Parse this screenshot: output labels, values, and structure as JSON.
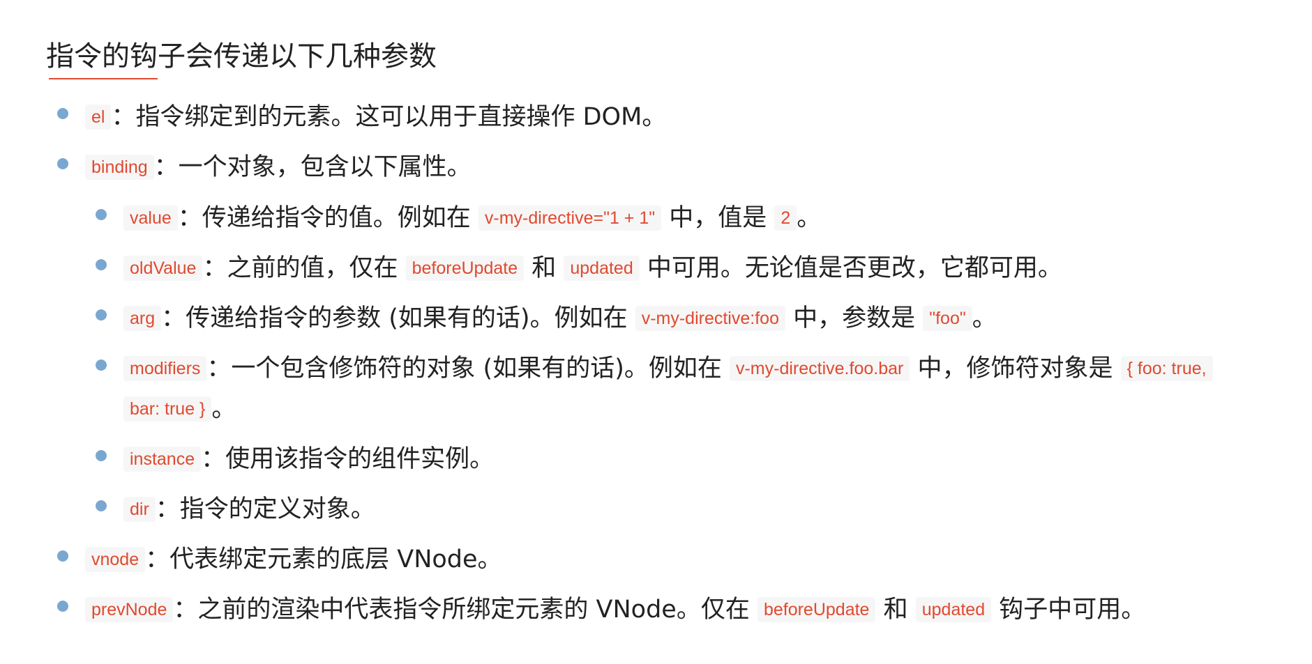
{
  "heading": "指令的钩子会传递以下几种参数",
  "colors": {
    "accent": "#e0492f",
    "bullet": "#7aa7d0",
    "code_bg": "#f6f6f6"
  },
  "items": [
    {
      "code": "el",
      "text": "：指令绑定到的元素。这可以用于直接操作 DOM。"
    },
    {
      "code": "binding",
      "text": "：一个对象，包含以下属性。",
      "children": [
        {
          "code": "value",
          "text1": "：传递给指令的值。例如在 ",
          "code2": "v-my-directive=\"1 + 1\"",
          "text2": " 中，值是 ",
          "code3": "2",
          "text3": "。"
        },
        {
          "code": "oldValue",
          "text1": "：之前的值，仅在 ",
          "code2": "beforeUpdate",
          "text2": " 和 ",
          "code3": "updated",
          "text3": " 中可用。无论值是否更改，它都可用。"
        },
        {
          "code": "arg",
          "text1": "：传递给指令的参数 (如果有的话)。例如在 ",
          "code2": "v-my-directive:foo",
          "text2": " 中，参数是 ",
          "code3": "\"foo\"",
          "text3": "。"
        },
        {
          "code": "modifiers",
          "text1": "：一个包含修饰符的对象 (如果有的话)。例如在 ",
          "code2": "v-my-directive.foo.bar",
          "text2": " 中，修饰符对象是 ",
          "code3a": "{ foo: true,",
          "code3b": "bar: true }",
          "text3": "。"
        },
        {
          "code": "instance",
          "text": "：使用该指令的组件实例。"
        },
        {
          "code": "dir",
          "text": "：指令的定义对象。"
        }
      ]
    },
    {
      "code": "vnode",
      "text": "：代表绑定元素的底层 VNode。"
    },
    {
      "code": "prevNode",
      "text1": "：之前的渲染中代表指令所绑定元素的 VNode。仅在 ",
      "code2": "beforeUpdate",
      "text2": " 和 ",
      "code3": "updated",
      "text3": " 钩子中可用。"
    }
  ]
}
